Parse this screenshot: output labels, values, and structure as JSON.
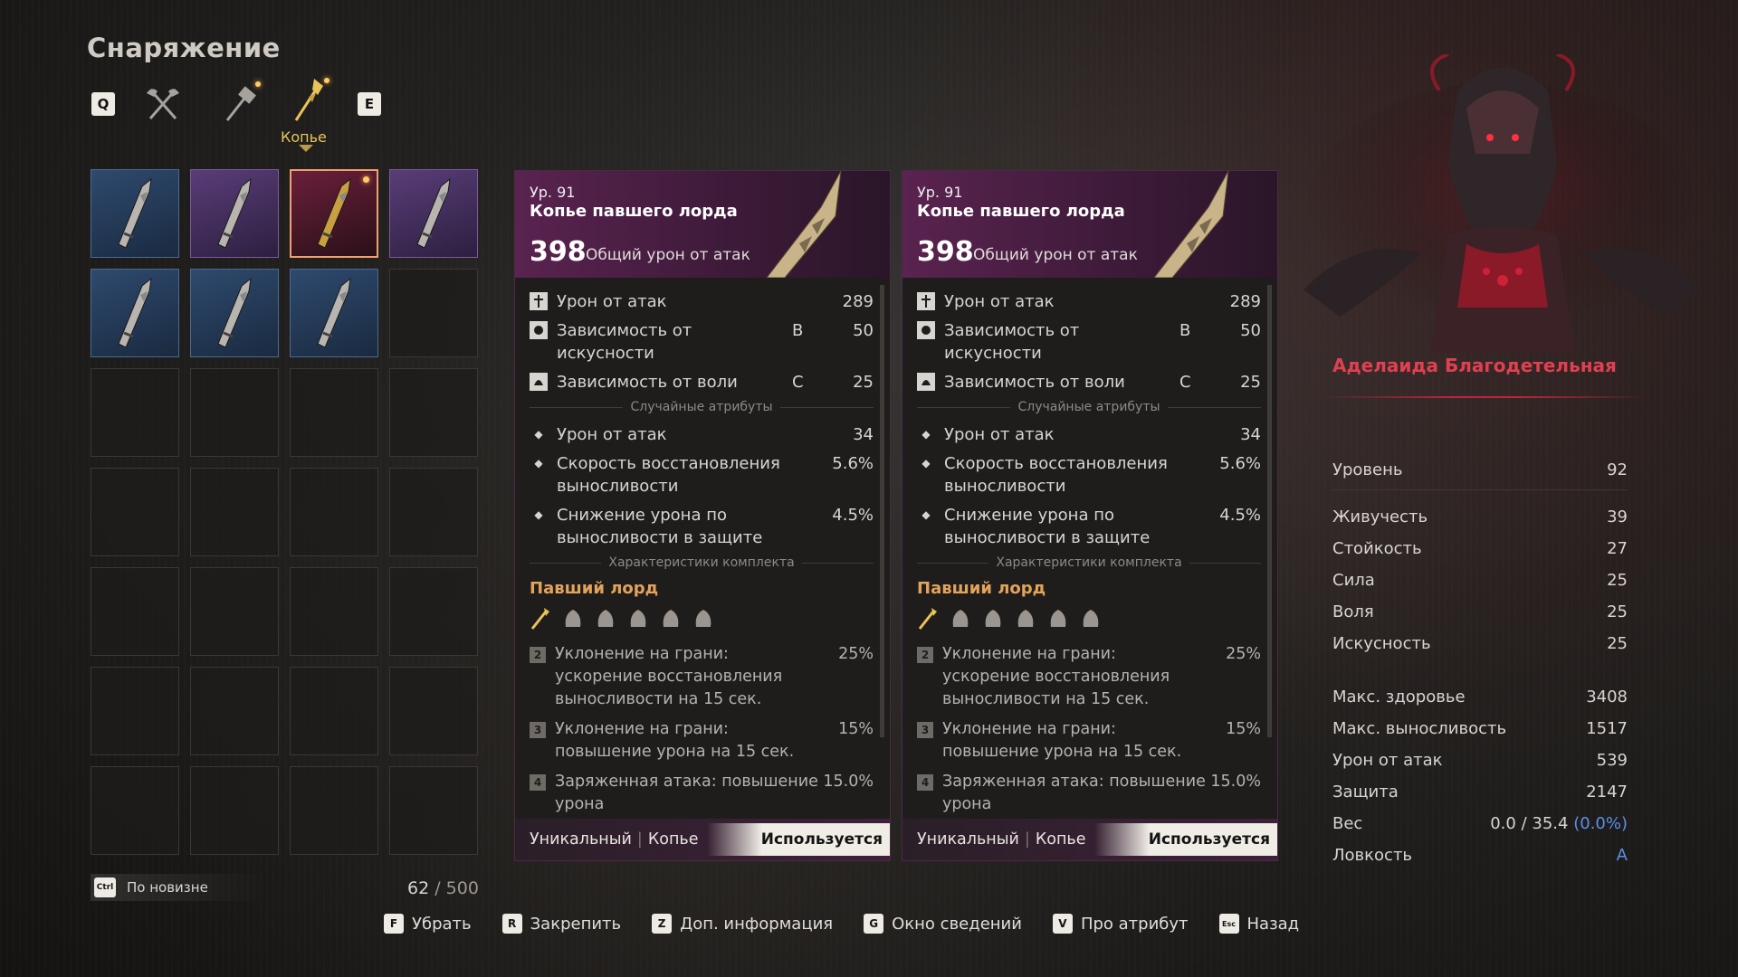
{
  "title": "Снаряжение",
  "tabs": {
    "left_key": "Q",
    "right_key": "E",
    "items": [
      {
        "icon": "axe-icon"
      },
      {
        "icon": "hammer-icon"
      },
      {
        "icon": "spear-icon"
      }
    ],
    "active_label": "Копье"
  },
  "inventory": {
    "slots": [
      {
        "rarity": "blue",
        "icon": "spear-icon"
      },
      {
        "rarity": "purple",
        "icon": "spear-icon"
      },
      {
        "rarity": "selected",
        "icon": "spear-icon"
      },
      {
        "rarity": "purple",
        "icon": "spear-icon"
      },
      {
        "rarity": "blue",
        "icon": "spear-icon"
      },
      {
        "rarity": "blue",
        "icon": "spear-icon"
      },
      {
        "rarity": "blue",
        "icon": "spear-icon"
      }
    ],
    "sort_key": "Ctrl",
    "sort_label": "По новизне",
    "count": "62",
    "capacity": "/ 500"
  },
  "cards": [
    {
      "level": "Ур. 91",
      "name": "Копье павшего лорда",
      "damage": "398",
      "damage_label": "Общий урон от атак",
      "stats": [
        {
          "icon": "sword-icon",
          "name": "Урон от атак",
          "grade": "",
          "value": "289"
        },
        {
          "icon": "skill-icon",
          "name": "Зависимость от искусности",
          "grade": "B",
          "value": "50"
        },
        {
          "icon": "will-icon",
          "name": "Зависимость от воли",
          "grade": "C",
          "value": "25"
        }
      ],
      "random_title": "Случайные атрибуты",
      "random": [
        {
          "name": "Урон от атак",
          "value": "34"
        },
        {
          "name": "Скорость восстановления выносливости",
          "value": "5.6%"
        },
        {
          "name": "Снижение урона по выносливости в защите",
          "value": "4.5%"
        }
      ],
      "set_title": "Характеристики комплекта",
      "set_name": "Павший лорд",
      "bonuses": [
        {
          "n": "2",
          "text": "Уклонение на грани: ускорение восстановления выносливости на 15 сек.",
          "value": "25%"
        },
        {
          "n": "3",
          "text": "Уклонение на грани: повышение урона на 15 сек.",
          "value": "15%"
        },
        {
          "n": "4",
          "text": "Заряженная атака: повышение урона",
          "value": "15.0%"
        }
      ],
      "rarity": "Уникальный",
      "type": "Копье",
      "status": "Используется"
    },
    {
      "level": "Ур. 91",
      "name": "Копье павшего лорда",
      "damage": "398",
      "damage_label": "Общий урон от атак",
      "stats": [
        {
          "icon": "sword-icon",
          "name": "Урон от атак",
          "grade": "",
          "value": "289"
        },
        {
          "icon": "skill-icon",
          "name": "Зависимость от искусности",
          "grade": "B",
          "value": "50"
        },
        {
          "icon": "will-icon",
          "name": "Зависимость от воли",
          "grade": "C",
          "value": "25"
        }
      ],
      "random_title": "Случайные атрибуты",
      "random": [
        {
          "name": "Урон от атак",
          "value": "34"
        },
        {
          "name": "Скорость восстановления выносливости",
          "value": "5.6%"
        },
        {
          "name": "Снижение урона по выносливости в защите",
          "value": "4.5%"
        }
      ],
      "set_title": "Характеристики комплекта",
      "set_name": "Павший лорд",
      "bonuses": [
        {
          "n": "2",
          "text": "Уклонение на грани: ускорение восстановления выносливости на 15 сек.",
          "value": "25%"
        },
        {
          "n": "3",
          "text": "Уклонение на грани: повышение урона на 15 сек.",
          "value": "15%"
        },
        {
          "n": "4",
          "text": "Заряженная атака: повышение урона",
          "value": "15.0%"
        }
      ],
      "rarity": "Уникальный",
      "type": "Копье",
      "status": "Используется"
    }
  ],
  "character": {
    "name": "Аделаида Благодетельная",
    "level_label": "Уровень",
    "level": "92",
    "attributes": [
      {
        "label": "Живучесть",
        "value": "39"
      },
      {
        "label": "Стойкость",
        "value": "27"
      },
      {
        "label": "Сила",
        "value": "25"
      },
      {
        "label": "Воля",
        "value": "25"
      },
      {
        "label": "Искусность",
        "value": "25"
      }
    ],
    "derived": [
      {
        "label": "Макс. здоровье",
        "value": "3408"
      },
      {
        "label": "Макс. выносливость",
        "value": "1517"
      },
      {
        "label": "Урон от атак",
        "value": "539"
      },
      {
        "label": "Защита",
        "value": "2147"
      }
    ],
    "weight_label": "Вес",
    "weight_value": "0.0",
    "weight_max": "/ 35.4",
    "weight_pct": "(0.0%)",
    "agility_label": "Ловкость",
    "agility_value": "A"
  },
  "hints": [
    {
      "key": "F",
      "label": "Убрать"
    },
    {
      "key": "R",
      "label": "Закрепить"
    },
    {
      "key": "Z",
      "label": "Доп. информация"
    },
    {
      "key": "G",
      "label": "Окно сведений"
    },
    {
      "key": "V",
      "label": "Про атрибут"
    },
    {
      "key": "Esc",
      "label": "Назад"
    }
  ],
  "colors": {
    "accent": "#e8c35a",
    "set": "#e2a35a",
    "boss": "#e04050",
    "blue": "#5c8fe6"
  }
}
